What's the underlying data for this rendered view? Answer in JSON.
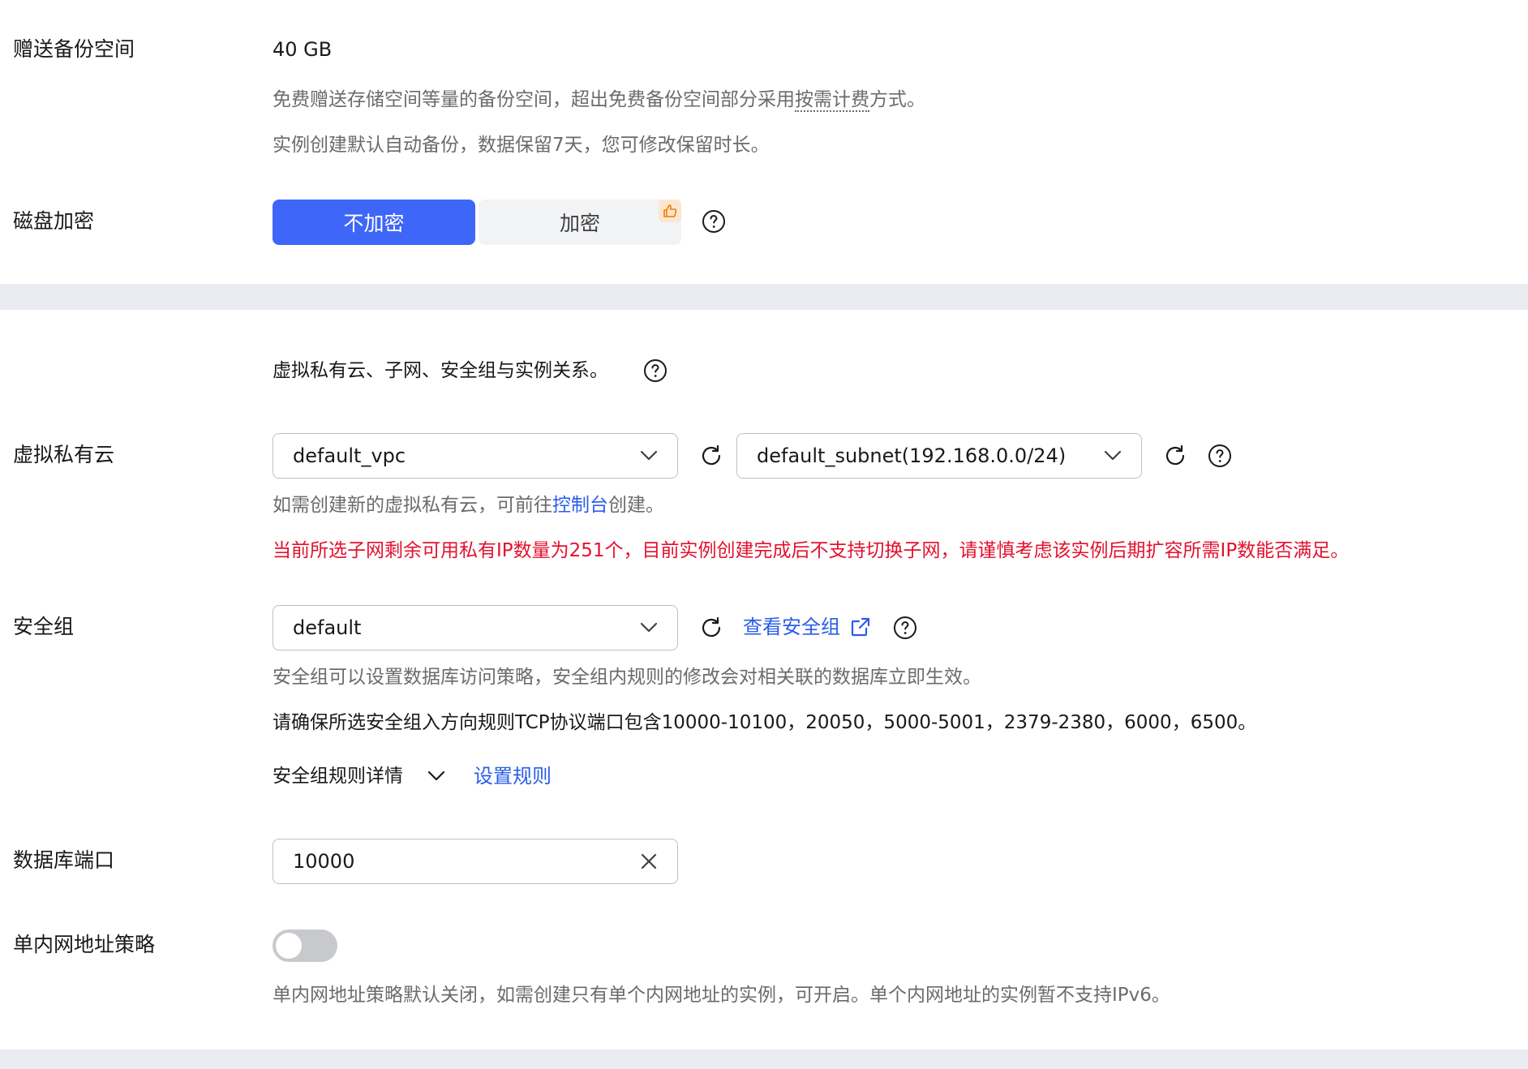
{
  "backup": {
    "label": "赠送备份空间",
    "value": "40 GB",
    "hint1_pre": "免费赠送存储空间等量的备份空间，超出免费备份空间部分采用",
    "hint1_link": "按需计费",
    "hint1_post": "方式。",
    "hint2": "实例创建默认自动备份，数据保留7天，您可修改保留时长。"
  },
  "encryption": {
    "label": "磁盘加密",
    "options": [
      "不加密",
      "加密"
    ],
    "selected": "不加密"
  },
  "network": {
    "relation_text": "虚拟私有云、子网、安全组与实例关系。",
    "vpc_label": "虚拟私有云",
    "vpc_value": "default_vpc",
    "subnet_value": "default_subnet(192.168.0.0/24)",
    "vpc_hint_pre": "如需创建新的虚拟私有云，可前往",
    "vpc_hint_link": "控制台",
    "vpc_hint_post": "创建。",
    "ip_warning": "当前所选子网剩余可用私有IP数量为251个，目前实例创建完成后不支持切换子网，请谨慎考虑该实例后期扩容所需IP数能否满足。"
  },
  "security_group": {
    "label": "安全组",
    "value": "default",
    "view_link": "查看安全组",
    "hint": "安全组可以设置数据库访问策略，安全组内规则的修改会对相关联的数据库立即生效。",
    "ports_note": "请确保所选安全组入方向规则TCP协议端口包含10000-10100，20050，5000-5001，2379-2380，6000，6500。",
    "rules_detail": "安全组规则详情",
    "set_rules": "设置规则"
  },
  "db_port": {
    "label": "数据库端口",
    "value": "10000"
  },
  "single_ip": {
    "label": "单内网地址策略",
    "enabled": false,
    "hint": "单内网地址策略默认关闭，如需创建只有单个内网地址的实例，可开启。单个内网地址的实例暂不支持IPv6。"
  },
  "colors": {
    "accent": "#3e66f8",
    "link": "#2a5cea",
    "warning": "#e3112e",
    "band": "#eaecf2"
  }
}
